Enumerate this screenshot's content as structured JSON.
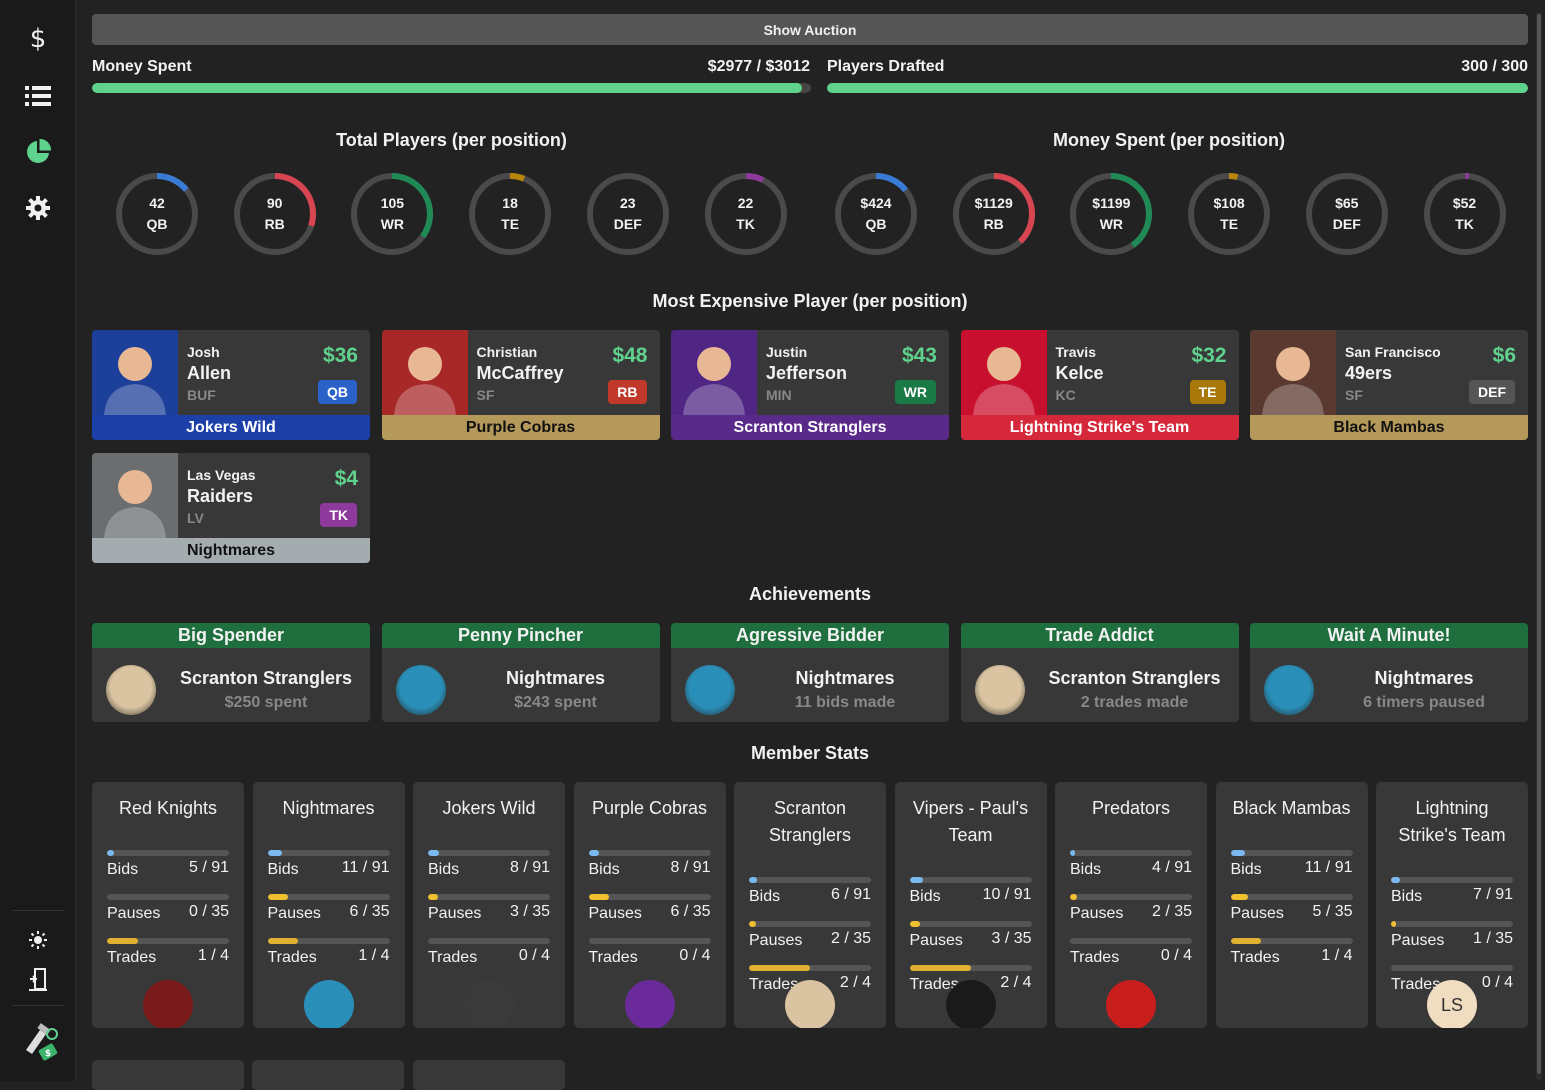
{
  "sidebar": {
    "icons": [
      "dollar-icon",
      "list-icon",
      "pie-chart-icon",
      "gear-icon",
      "sun-icon",
      "exit-icon",
      "app-logo-icon"
    ]
  },
  "header": {
    "show_auction": "Show Auction",
    "money_spent_label": "Money Spent",
    "money_spent_value": "$2977 / $3012",
    "money_spent_fraction": 0.988,
    "players_drafted_label": "Players Drafted",
    "players_drafted_value": "300 / 300",
    "players_drafted_fraction": 1.0
  },
  "totals": {
    "players_title": "Total Players (per position)",
    "money_title": "Money Spent (per position)",
    "players": [
      {
        "value": "42",
        "pos": "QB",
        "fraction": 0.14,
        "color": "#3a7bd5"
      },
      {
        "value": "90",
        "pos": "RB",
        "fraction": 0.3,
        "color": "#d64550"
      },
      {
        "value": "105",
        "pos": "WR",
        "fraction": 0.35,
        "color": "#1f8a55"
      },
      {
        "value": "18",
        "pos": "TE",
        "fraction": 0.06,
        "color": "#b8860b"
      },
      {
        "value": "23",
        "pos": "DEF",
        "fraction": 0.077,
        "color": "#4a4a4a"
      },
      {
        "value": "22",
        "pos": "TK",
        "fraction": 0.073,
        "color": "#8e3a9d"
      }
    ],
    "money": [
      {
        "value": "$424",
        "pos": "QB",
        "fraction": 0.142,
        "color": "#3a7bd5"
      },
      {
        "value": "$1129",
        "pos": "RB",
        "fraction": 0.379,
        "color": "#d64550"
      },
      {
        "value": "$1199",
        "pos": "WR",
        "fraction": 0.403,
        "color": "#1f8a55"
      },
      {
        "value": "$108",
        "pos": "TE",
        "fraction": 0.036,
        "color": "#b8860b"
      },
      {
        "value": "$65",
        "pos": "DEF",
        "fraction": 0.022,
        "color": "#4a4a4a"
      },
      {
        "value": "$52",
        "pos": "TK",
        "fraction": 0.017,
        "color": "#8e3a9d"
      }
    ]
  },
  "expensive": {
    "title": "Most Expensive Player (per position)",
    "players": [
      {
        "first": "Josh",
        "last": "Allen",
        "team": "BUF",
        "price": "$36",
        "pos": "QB",
        "owner": "Jokers Wild",
        "pos_color": "#2a62c9",
        "owner_color": "#1d3fa8",
        "photo_color": "#1c3f99"
      },
      {
        "first": "Christian",
        "last": "McCaffrey",
        "team": "SF",
        "price": "$48",
        "pos": "RB",
        "owner": "Purple Cobras",
        "pos_color": "#c0392b",
        "owner_color": "#b5995a",
        "photo_color": "#a82828"
      },
      {
        "first": "Justin",
        "last": "Jefferson",
        "team": "MIN",
        "price": "$43",
        "pos": "WR",
        "owner": "Scranton Stranglers",
        "pos_color": "#1a7a46",
        "owner_color": "#5a2a8a",
        "photo_color": "#4f2683"
      },
      {
        "first": "Travis",
        "last": "Kelce",
        "team": "KC",
        "price": "$32",
        "pos": "TE",
        "owner": "Lightning Strike's Team",
        "pos_color": "#a8780b",
        "owner_color": "#d6283b",
        "photo_color": "#c8102e"
      },
      {
        "first": "San Francisco",
        "last": "49ers",
        "team": "SF",
        "price": "$6",
        "pos": "DEF",
        "owner": "Black Mambas",
        "pos_color": "#555555",
        "owner_color": "#b5995a",
        "photo_color": "#5a3a30"
      },
      {
        "first": "Las Vegas",
        "last": "Raiders",
        "team": "LV",
        "price": "$4",
        "pos": "TK",
        "owner": "Nightmares",
        "pos_color": "#8e3a9d",
        "owner_color": "#a5acaf",
        "photo_color": "#6a6e70"
      }
    ]
  },
  "achievements": {
    "title": "Achievements",
    "items": [
      {
        "title": "Big Spender",
        "team": "Scranton Stranglers",
        "stat": "$250 spent",
        "logo_color": "#d9c3a0"
      },
      {
        "title": "Penny Pincher",
        "team": "Nightmares",
        "stat": "$243 spent",
        "logo_color": "#2a8fb8"
      },
      {
        "title": "Agressive Bidder",
        "team": "Nightmares",
        "stat": "11 bids made",
        "logo_color": "#2a8fb8"
      },
      {
        "title": "Trade Addict",
        "team": "Scranton Stranglers",
        "stat": "2 trades made",
        "logo_color": "#d9c3a0"
      },
      {
        "title": "Wait A Minute!",
        "team": "Nightmares",
        "stat": "6 timers paused",
        "logo_color": "#2a8fb8"
      }
    ]
  },
  "members": {
    "title": "Member Stats",
    "labels": {
      "bids": "Bids",
      "pauses": "Pauses",
      "trades": "Trades"
    },
    "teams": [
      {
        "name": "Red Knights",
        "bids": "5 / 91",
        "bids_f": 0.055,
        "pauses": "0 / 35",
        "pauses_f": 0,
        "trades": "1 / 4",
        "trades_f": 0.25,
        "logo": "",
        "logo_color": "#7a1a1a"
      },
      {
        "name": "Nightmares",
        "bids": "11 / 91",
        "bids_f": 0.121,
        "pauses": "6 / 35",
        "pauses_f": 0.171,
        "trades": "1 / 4",
        "trades_f": 0.25,
        "logo": "",
        "logo_color": "#2a8fb8"
      },
      {
        "name": "Jokers Wild",
        "bids": "8 / 91",
        "bids_f": 0.088,
        "pauses": "3 / 35",
        "pauses_f": 0.086,
        "trades": "0 / 4",
        "trades_f": 0,
        "logo": "",
        "logo_color": "#3a3a3a"
      },
      {
        "name": "Purple Cobras",
        "bids": "8 / 91",
        "bids_f": 0.088,
        "pauses": "6 / 35",
        "pauses_f": 0.171,
        "trades": "0 / 4",
        "trades_f": 0,
        "logo": "",
        "logo_color": "#6a2a9a"
      },
      {
        "name": "Scranton Stranglers",
        "bids": "6 / 91",
        "bids_f": 0.066,
        "pauses": "2 / 35",
        "pauses_f": 0.057,
        "trades": "2 / 4",
        "trades_f": 0.5,
        "logo": "",
        "logo_color": "#d9c3a0"
      },
      {
        "name": "Vipers - Paul's Team",
        "bids": "10 / 91",
        "bids_f": 0.11,
        "pauses": "3 / 35",
        "pauses_f": 0.086,
        "trades": "2 / 4",
        "trades_f": 0.5,
        "logo": "",
        "logo_color": "#1a1a1a"
      },
      {
        "name": "Predators",
        "bids": "4 / 91",
        "bids_f": 0.044,
        "pauses": "2 / 35",
        "pauses_f": 0.057,
        "trades": "0 / 4",
        "trades_f": 0,
        "logo": "",
        "logo_color": "#c81e1e"
      },
      {
        "name": "Black Mambas",
        "bids": "11 / 91",
        "bids_f": 0.121,
        "pauses": "5 / 35",
        "pauses_f": 0.143,
        "trades": "1 / 4",
        "trades_f": 0.25,
        "logo": "",
        "logo_color": "#383838"
      },
      {
        "name": "Lightning Strike's Team",
        "bids": "7 / 91",
        "bids_f": 0.077,
        "pauses": "1 / 35",
        "pauses_f": 0.029,
        "trades": "0 / 4",
        "trades_f": 0,
        "logo": "LS",
        "logo_color": "#f0dcc0"
      }
    ],
    "bar_colors": {
      "bids": "#7ab8f0",
      "pauses": "#f0c030",
      "trades": "#e0b030"
    }
  }
}
